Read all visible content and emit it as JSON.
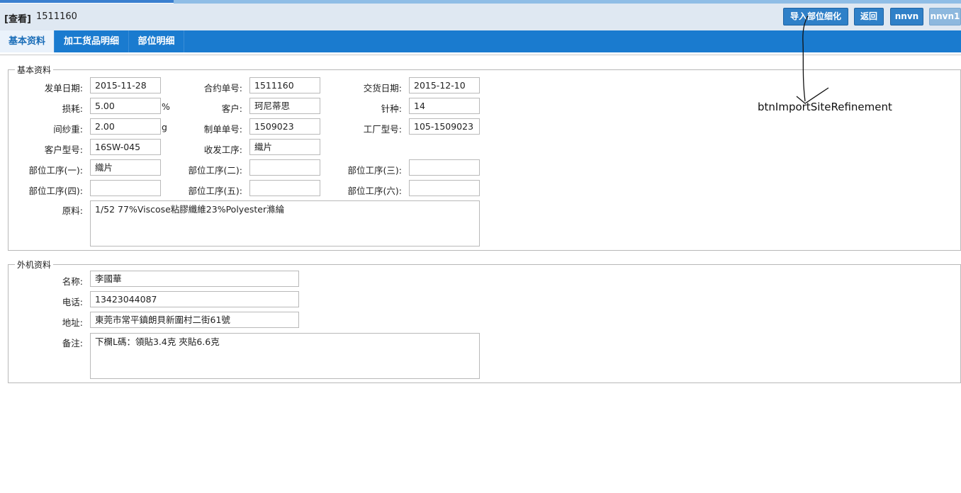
{
  "header": {
    "mode": "[查看]",
    "doc_no": "1511160"
  },
  "toolbar": {
    "import_label": "导入部位细化",
    "back_label": "返回",
    "nnvn_label": "nnvn",
    "nnvn1_label": "nnvn1"
  },
  "tabs": [
    {
      "label": "基本资料",
      "active": true
    },
    {
      "label": "加工货品明细",
      "active": false
    },
    {
      "label": "部位明细",
      "active": false
    }
  ],
  "basic": {
    "legend": "基本资料",
    "order_date": {
      "label": "发单日期:",
      "value": "2015-11-28"
    },
    "contract_no": {
      "label": "合约单号:",
      "value": "1511160"
    },
    "delivery_date": {
      "label": "交货日期:",
      "value": "2015-12-10"
    },
    "loss": {
      "label": "损耗:",
      "value": "5.00",
      "unit": "%"
    },
    "customer": {
      "label": "客户:",
      "value": "珂尼蒂思"
    },
    "needle": {
      "label": "针种:",
      "value": "14"
    },
    "yarn_weight": {
      "label": "间纱重:",
      "value": "2.00",
      "unit": "g"
    },
    "make_no": {
      "label": "制单单号:",
      "value": "1509023"
    },
    "factory_model": {
      "label": "工厂型号:",
      "value": "105-1509023"
    },
    "customer_model": {
      "label": "客户型号:",
      "value": "16SW-045"
    },
    "dispatch_process": {
      "label": "收发工序:",
      "value": "織片"
    },
    "part1": {
      "label": "部位工序(一):",
      "value": "織片"
    },
    "part2": {
      "label": "部位工序(二):",
      "value": ""
    },
    "part3": {
      "label": "部位工序(三):",
      "value": ""
    },
    "part4": {
      "label": "部位工序(四):",
      "value": ""
    },
    "part5": {
      "label": "部位工序(五):",
      "value": ""
    },
    "part6": {
      "label": "部位工序(六):",
      "value": ""
    },
    "material": {
      "label": "原料:",
      "value": "1/52 77%Viscose粘膠纖維23%Polyester滌綸"
    }
  },
  "external": {
    "legend": "外机资料",
    "name": {
      "label": "名称:",
      "value": "李國華"
    },
    "phone": {
      "label": "电话:",
      "value": "13423044087"
    },
    "address": {
      "label": "地址:",
      "value": "東莞市常平鎮朗貝新圍村二街61號"
    },
    "remark": {
      "label": "备注:",
      "value": "下欄L碼：領貼3.4克  夾貼6.6克"
    }
  },
  "annotation": "btnImportSiteRefinement"
}
